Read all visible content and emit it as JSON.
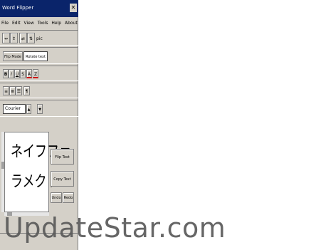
{
  "window": {
    "title": "Word Flipper",
    "close_glyph": "✕"
  },
  "menu": {
    "items": [
      "File",
      "Edit",
      "View",
      "Tools",
      "Help",
      "About"
    ]
  },
  "toolbar1": {
    "buttons": [
      "↔",
      "↕",
      "⇄",
      "⇅"
    ],
    "more_label": "pic"
  },
  "mode": {
    "primary_label": "Flip Mode",
    "secondary_value": "Rotate text"
  },
  "format": {
    "buttons": [
      "B",
      "I",
      "U",
      "S",
      "A",
      "Z"
    ]
  },
  "align": {
    "buttons": [
      "≡",
      "≣",
      "☰",
      "¶"
    ]
  },
  "font": {
    "value": "Courier",
    "size_up": "▲",
    "size_down": "▼"
  },
  "preview": {
    "line1": "ネイフファ",
    "line2": "ラメクト："
  },
  "actions": {
    "flip_button": "Flip Text",
    "copy_button": "Copy Text",
    "small1": "Undo",
    "small2": "Redo"
  },
  "watermark": {
    "text": "UpdateStar.com"
  }
}
